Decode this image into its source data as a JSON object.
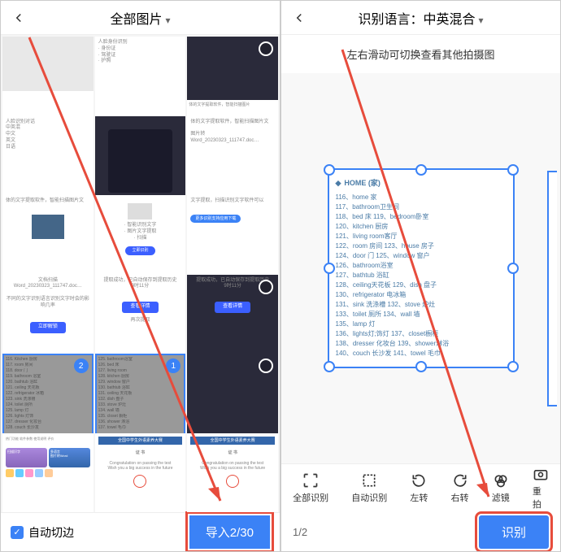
{
  "left": {
    "title": "全部图片",
    "auto_crop": "自动切边",
    "import_btn": "导入2/30",
    "thumbs": [
      {
        "filename": "Word_20230323_111747.doc…"
      },
      {
        "filename": "Word_20230323_111747.doc…"
      }
    ],
    "selected": [
      2,
      1
    ]
  },
  "right": {
    "title": "识别语言：中英混合",
    "hint": "左右滑动可切换查看其他拍摄图",
    "doc_title": "HOME (家)",
    "doc_lines": [
      "116、home 家",
      "117、bathroom卫生间",
      "118、bed 床        119、bedroom卧室",
      "120、kitchen 厨房",
      "121、living room客厅",
      "122、room 房间     123、house 房子",
      "124、door 门       125、window 窗户",
      "126、bathroom浴室",
      "127、bathtub 浴缸",
      "128、ceiling天花板  129、dish 盘子",
      "130、refrigerator  电冰箱",
      "131、sink 洗涤槽    132、stove 炉灶",
      "133、toilet 厕所    134、wall 墙",
      "135、lamp 灯",
      "136、lights灯;饰灯  137、closet橱柜",
      "138、dresser 化妆台 139、shower淋浴",
      "140、couch 长沙发   141、towel 毛巾"
    ],
    "tools": {
      "full": "全部识别",
      "auto": "自动识别",
      "left": "左转",
      "right": "右转",
      "filter": "滤镜",
      "retake": "重拍"
    },
    "page": "1/2",
    "recognize_btn": "识别"
  }
}
